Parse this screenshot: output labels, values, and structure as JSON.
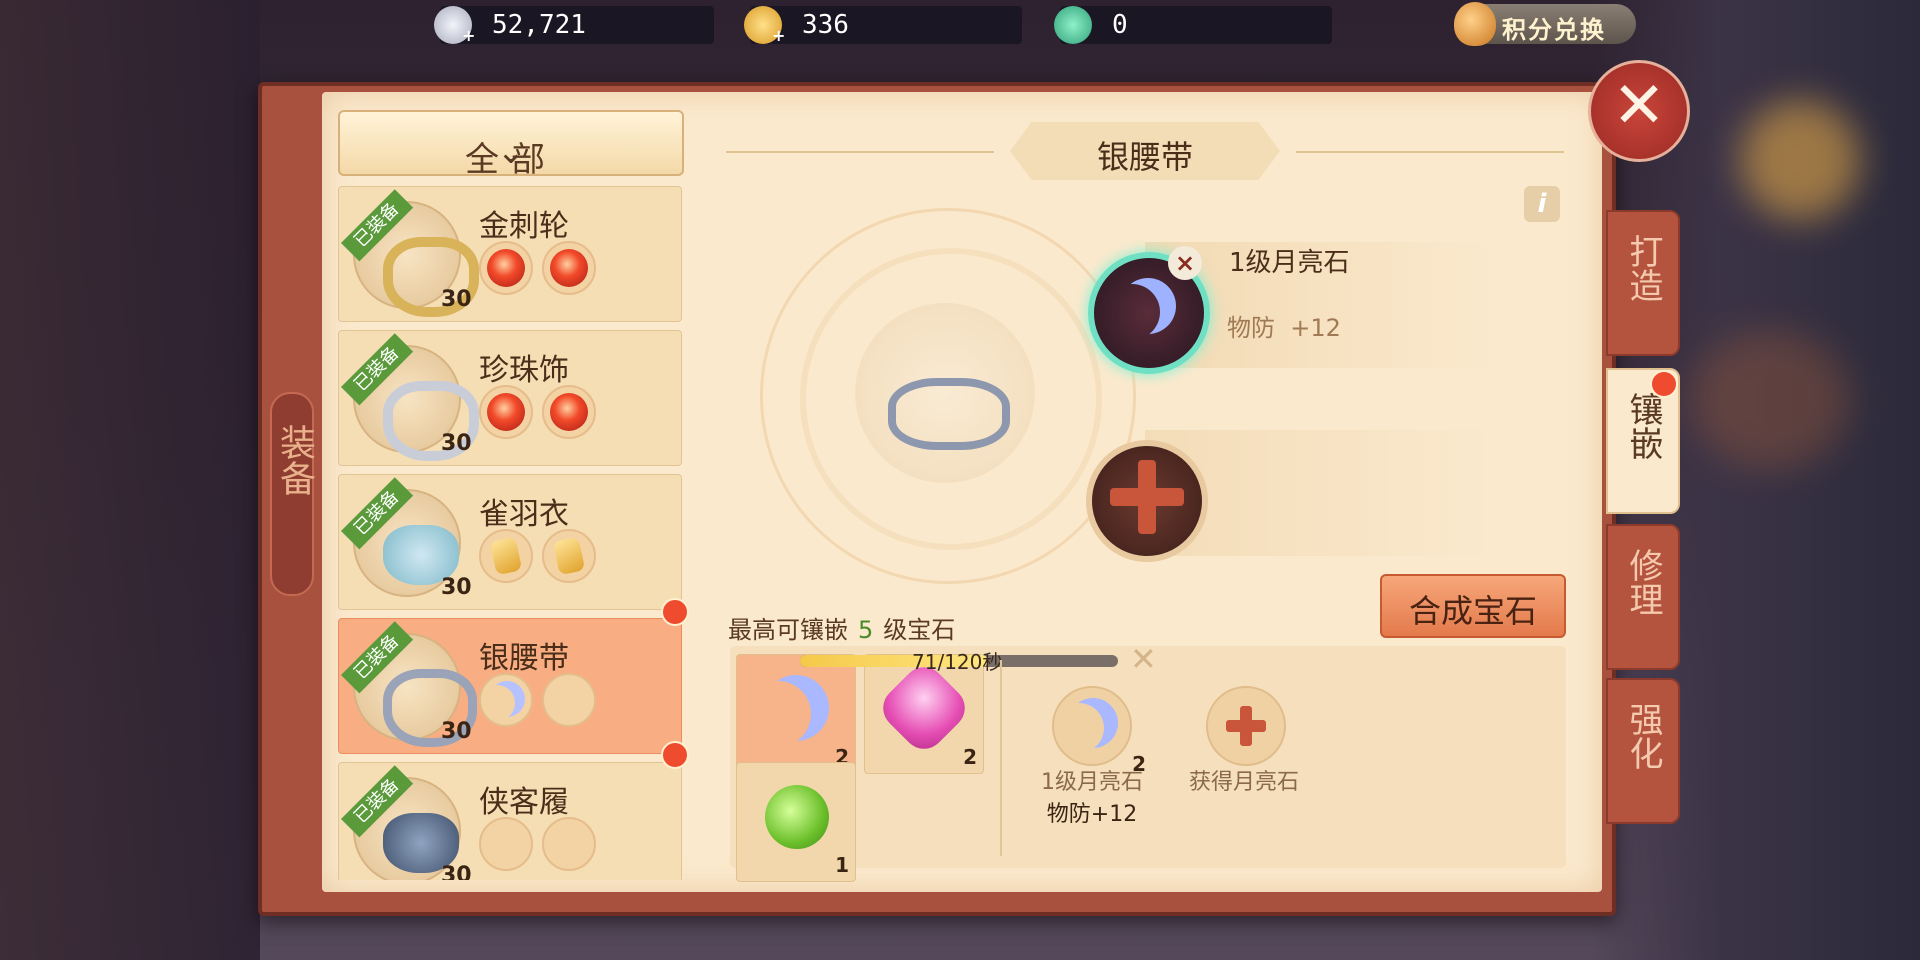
{
  "currency": [
    {
      "icon": "silver-coin-icon",
      "value": "52,721"
    },
    {
      "icon": "gold-coin-icon",
      "value": "336"
    },
    {
      "icon": "jade-icon",
      "value": "0"
    }
  ],
  "exchange_label": "积分兑换",
  "side_label": "装备",
  "filter": {
    "label": "全部",
    "icon": "chevron-down-icon"
  },
  "equipment_list": [
    {
      "name": "金刺轮",
      "level": "30",
      "badge": "已装备",
      "slots": [
        "red-gem",
        "red-gem"
      ],
      "selected": false
    },
    {
      "name": "珍珠饰",
      "level": "30",
      "badge": "已装备",
      "slots": [
        "red-gem",
        "red-gem"
      ],
      "selected": false
    },
    {
      "name": "雀羽衣",
      "level": "30",
      "badge": "已装备",
      "slots": [
        "yellow-gem",
        "yellow-gem"
      ],
      "selected": false
    },
    {
      "name": "银腰带",
      "level": "30",
      "badge": "已装备",
      "slots": [
        "moon-gem",
        "empty"
      ],
      "selected": true
    },
    {
      "name": "侠客履",
      "level": "30",
      "badge": "已装备",
      "slots": [
        "empty",
        "empty"
      ],
      "selected": false
    }
  ],
  "main": {
    "title": "银腰带",
    "socket1": {
      "gem_name": "1级月亮石",
      "stat_label": "物防",
      "stat_value": "+12"
    },
    "compose_button": "合成宝石",
    "max_text_prefix": "最高可镶嵌",
    "max_level": "5",
    "max_text_suffix": "级宝石",
    "timer_text": "71/120秒",
    "timer_progress": 0.59
  },
  "inventory": [
    {
      "icon": "moon-gem",
      "count": "2",
      "selected": true
    },
    {
      "icon": "pink-gem",
      "count": "2",
      "selected": false
    },
    {
      "icon": "green-gem",
      "count": "1",
      "selected": false
    }
  ],
  "detail": {
    "gem_name": "1级月亮石",
    "gem_count": "2",
    "stat": "物防+12",
    "obtain_label": "获得月亮石"
  },
  "tabs": [
    "打造",
    "镶嵌",
    "修理",
    "强化"
  ],
  "active_tab": "镶嵌",
  "colors": {
    "accent": "#e47a4c",
    "frame": "#a8513f",
    "paper": "#fbe9cd"
  }
}
